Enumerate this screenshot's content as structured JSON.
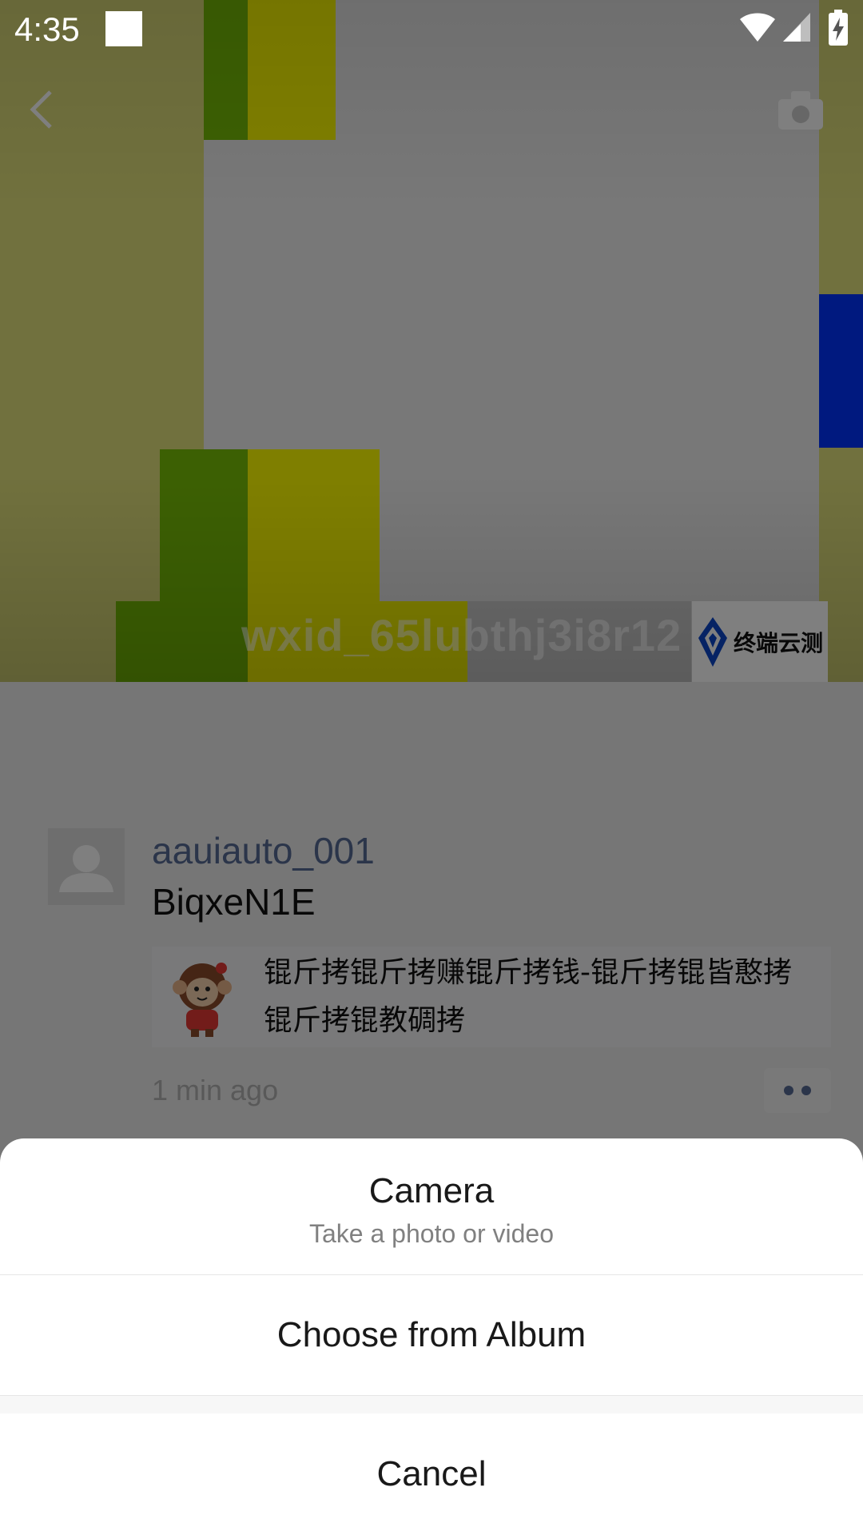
{
  "status_bar": {
    "time": "4:35"
  },
  "moments": {
    "cover_username": "wxid_65lubthj3i8r12",
    "watermark_text": "终端云测",
    "post": {
      "author": "aauiauto_001",
      "text": "BiqxeN1E",
      "link_title": "锟斤拷锟斤拷赚锟斤拷钱-锟斤拷锟皆憨拷锟斤拷锟教碉拷",
      "time": "1 min ago"
    }
  },
  "action_sheet": {
    "camera_title": "Camera",
    "camera_subtitle": "Take a photo or video",
    "album_label": "Choose from Album",
    "cancel_label": "Cancel"
  },
  "colors": {
    "author_link": "#576b95",
    "overlay": "rgba(0,0,0,0.5)",
    "sheet_bg": "#ffffff"
  }
}
